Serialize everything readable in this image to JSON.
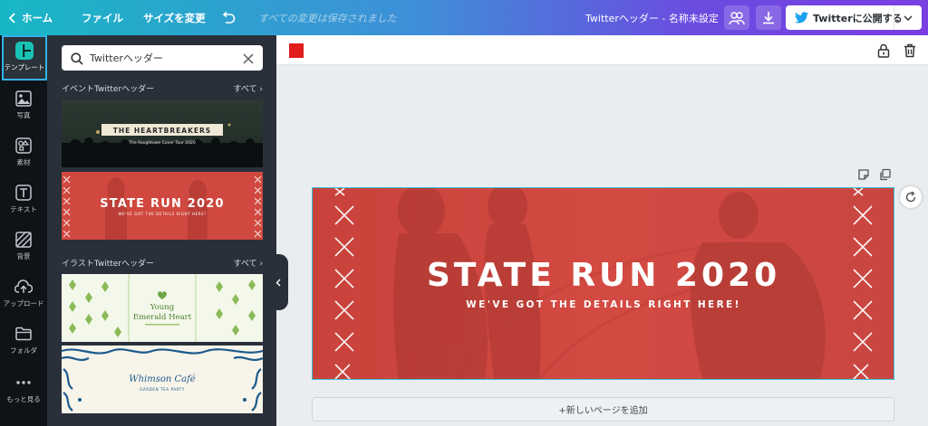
{
  "topbar": {
    "home_label": "ホーム",
    "file_label": "ファイル",
    "resize_label": "サイズを変更",
    "save_status": "すべての変更は保存されました",
    "doc_title": "Twitterヘッダー - 名称未設定",
    "publish_label": "Twitterに公開する",
    "icons": [
      "chevron-left-icon",
      "undo-icon",
      "share-people-icon",
      "download-icon",
      "twitter-icon",
      "chevron-down-icon"
    ]
  },
  "rail": {
    "items": [
      {
        "label": "テンプレート",
        "icon": "template-icon",
        "active": true
      },
      {
        "label": "写真",
        "icon": "photo-icon"
      },
      {
        "label": "素材",
        "icon": "elements-icon"
      },
      {
        "label": "テキスト",
        "icon": "text-icon"
      },
      {
        "label": "背景",
        "icon": "background-icon"
      },
      {
        "label": "アップロード",
        "icon": "upload-icon"
      },
      {
        "label": "フォルダ",
        "icon": "folder-icon"
      },
      {
        "label": "もっと見る",
        "icon": "more-icon"
      }
    ]
  },
  "panel": {
    "search_value": "Twitterヘッダー",
    "section1": {
      "title": "イベントTwitterヘッダー",
      "all": "すべて"
    },
    "section2": {
      "title": "イラストTwitterヘッダー",
      "all": "すべて"
    },
    "templates": {
      "t1": {
        "title": "THE HEARTBREAKERS",
        "subtitle": "The Roughtown Cover Tour 2020"
      },
      "t2": {
        "title": "STATE RUN 2020",
        "subtitle": "WE'VE GOT THE DETAILS RIGHT HERE!"
      },
      "t3": {
        "title_line1": "Young",
        "title_line2": "Emerald Heart"
      },
      "t4": {
        "title": "Whimson Café",
        "subtitle": "GARDEN TEA PARTY"
      }
    }
  },
  "canvas": {
    "accent_color": "#e11d1d",
    "design_title": "STATE RUN 2020",
    "design_subtitle": "WE'VE GOT THE DETAILS RIGHT HERE!",
    "add_page_label": "+新しいページを追加"
  },
  "colors": {
    "topbar_gradient_start": "#18b7c5",
    "topbar_gradient_end": "#7a3fe0",
    "panel_bg": "#293039",
    "rail_bg": "#0e1318",
    "design_red": "#d6453f",
    "selection": "#35c0dd"
  }
}
